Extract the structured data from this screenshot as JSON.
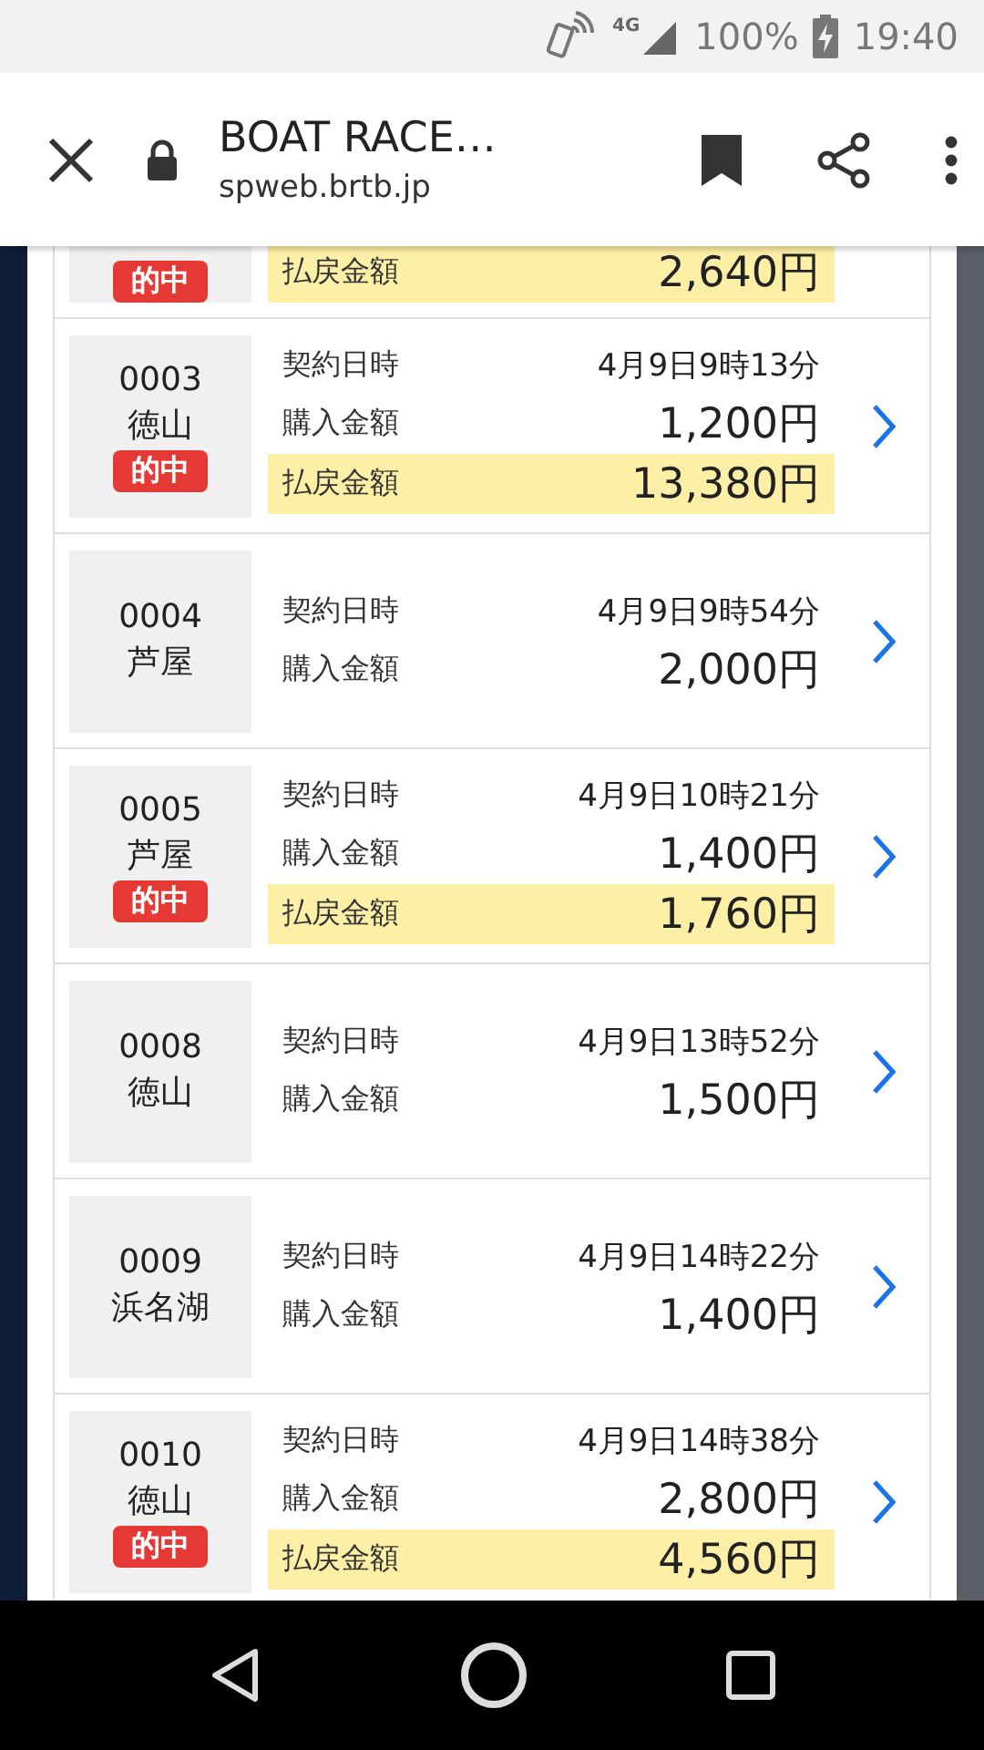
{
  "status_bar": {
    "network": "4G",
    "battery": "100%",
    "time": "19:40"
  },
  "toolbar": {
    "title": "BOAT RACE…",
    "url": "spweb.brtb.jp"
  },
  "tickets": [
    {
      "hit": true,
      "hit_label": "的中",
      "payout_label": "払戻金額",
      "payout": "2,640円"
    },
    {
      "id": "0003",
      "venue": "徳山",
      "hit": true,
      "hit_label": "的中",
      "date_label": "契約日時",
      "date": "4月9日9時13分",
      "purchase_label": "購入金額",
      "purchase": "1,200円",
      "payout_label": "払戻金額",
      "payout": "13,380円"
    },
    {
      "id": "0004",
      "venue": "芦屋",
      "hit": false,
      "date_label": "契約日時",
      "date": "4月9日9時54分",
      "purchase_label": "購入金額",
      "purchase": "2,000円"
    },
    {
      "id": "0005",
      "venue": "芦屋",
      "hit": true,
      "hit_label": "的中",
      "date_label": "契約日時",
      "date": "4月9日10時21分",
      "purchase_label": "購入金額",
      "purchase": "1,400円",
      "payout_label": "払戻金額",
      "payout": "1,760円"
    },
    {
      "id": "0008",
      "venue": "徳山",
      "hit": false,
      "date_label": "契約日時",
      "date": "4月9日13時52分",
      "purchase_label": "購入金額",
      "purchase": "1,500円"
    },
    {
      "id": "0009",
      "venue": "浜名湖",
      "hit": false,
      "date_label": "契約日時",
      "date": "4月9日14時22分",
      "purchase_label": "購入金額",
      "purchase": "1,400円"
    },
    {
      "id": "0010",
      "venue": "徳山",
      "hit": true,
      "hit_label": "的中",
      "date_label": "契約日時",
      "date": "4月9日14時38分",
      "purchase_label": "購入金額",
      "purchase": "2,800円",
      "payout_label": "払戻金額",
      "payout": "4,560円"
    }
  ]
}
